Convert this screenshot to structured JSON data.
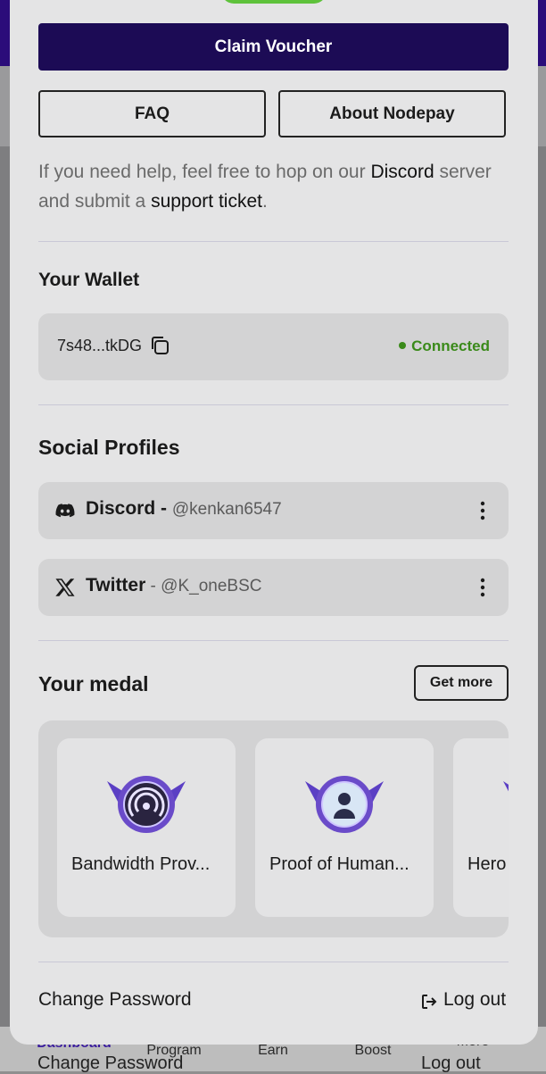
{
  "background": {
    "nav": [
      "Dashboard",
      "Program",
      "Earn",
      "Boost",
      "More"
    ],
    "behind_left": "Change Password",
    "behind_right": "Log out"
  },
  "actions": {
    "claim_voucher": "Claim Voucher",
    "faq": "FAQ",
    "about": "About Nodepay"
  },
  "help": {
    "prefix": "If you need help, feel free to hop on our ",
    "discord_link": "Discord",
    "middle": " server and submit a ",
    "support_link": "support ticket",
    "suffix": "."
  },
  "wallet": {
    "title": "Your Wallet",
    "address": "7s48...tkDG",
    "status": "Connected",
    "status_color": "#3a8a1a"
  },
  "social": {
    "title": "Social Profiles",
    "profiles": [
      {
        "platform": "Discord",
        "separator": " - ",
        "handle": "@kenkan6547",
        "icon": "discord-icon"
      },
      {
        "platform": "Twitter",
        "separator": " - ",
        "handle": "@K_oneBSC",
        "icon": "x-icon"
      }
    ]
  },
  "medals": {
    "title": "Your medal",
    "get_more": "Get more",
    "items": [
      {
        "label": "Bandwidth Prov...",
        "icon": "signal-medal-icon"
      },
      {
        "label": "Proof of Human...",
        "icon": "human-medal-icon"
      },
      {
        "label": "Hero",
        "icon": "hero-medal-icon"
      }
    ]
  },
  "footer": {
    "change_password": "Change Password",
    "logout": "Log out"
  },
  "colors": {
    "primary": "#1c0b55",
    "accent": "#5ec23b",
    "medal_purple": "#6a4bc9"
  }
}
